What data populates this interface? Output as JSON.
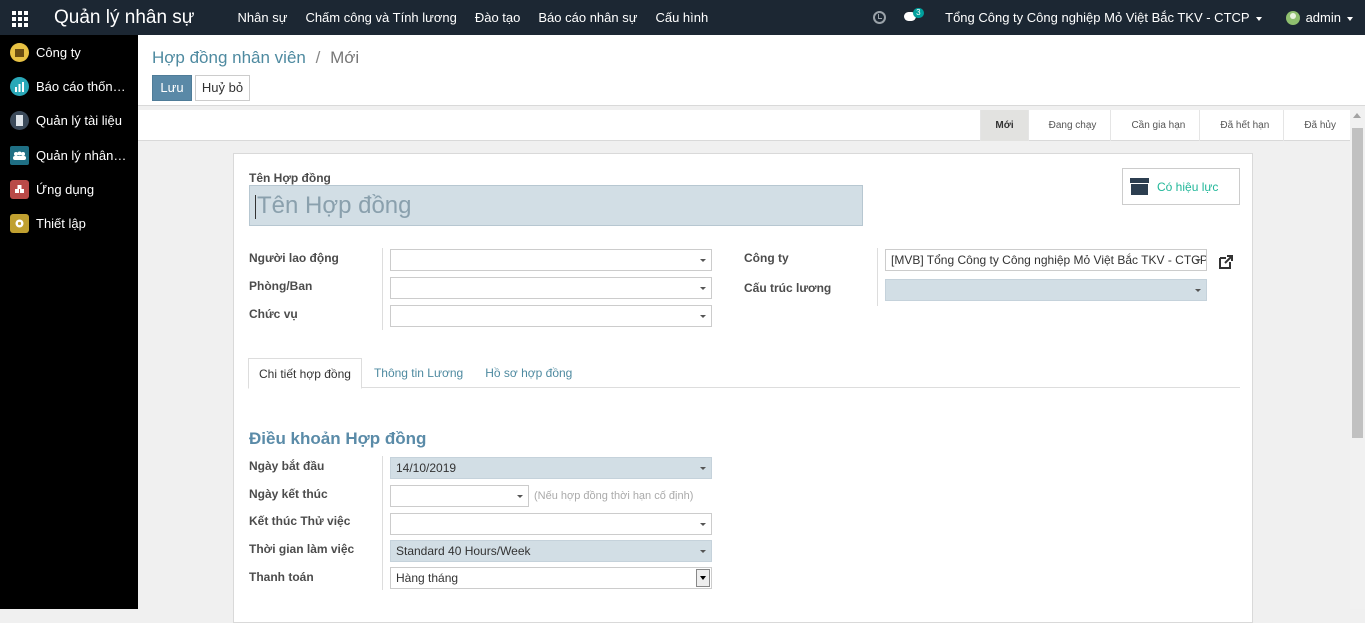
{
  "topbar": {
    "app_title": "Quản lý nhân sự",
    "menu": [
      "Nhân sự",
      "Chấm công và Tính lương",
      "Đào tạo",
      "Báo cáo nhân sự",
      "Cấu hình"
    ],
    "chat_count": "3",
    "company": "Tổng Công ty Công nghiệp Mỏ Việt Bắc TKV - CTCP",
    "user": "admin"
  },
  "sidebar": {
    "items": [
      {
        "label": "Công ty",
        "color": "#e8c244"
      },
      {
        "label": "Báo cáo thống kê",
        "color": "#2aa8b8"
      },
      {
        "label": "Quản lý tài liệu",
        "color": "#3b4a5a"
      },
      {
        "label": "Quản lý nhân sự",
        "color": "#1f6f84"
      },
      {
        "label": "Ứng dụng",
        "color": "#b94a48"
      },
      {
        "label": "Thiết lập",
        "color": "#c0a030"
      }
    ]
  },
  "breadcrumb": {
    "parent": "Hợp đồng nhân viên",
    "separator": "/",
    "current": "Mới"
  },
  "buttons": {
    "save": "Lưu",
    "cancel": "Huỷ bỏ"
  },
  "stages": [
    "Mới",
    "Đang chạy",
    "Cần gia hạn",
    "Đã hết hạn",
    "Đã hủy"
  ],
  "form": {
    "name_label": "Tên Hợp đồng",
    "name_placeholder": "Tên Hợp đồng",
    "smart_button": "Có hiệu lực",
    "employee_label": "Người lao động",
    "department_label": "Phòng/Ban",
    "job_label": "Chức vụ",
    "company_label": "Công ty",
    "company_value": "[MVB] Tổng Công ty Công nghiệp Mỏ Việt Bắc TKV - CTCP",
    "structure_label": "Cấu trúc lương",
    "tabs": [
      "Chi tiết hợp đồng",
      "Thông tin Lương",
      "Hồ sơ hợp đồng"
    ],
    "section_title": "Điều khoản Hợp đồng",
    "start_label": "Ngày bắt đầu",
    "start_value": "14/10/2019",
    "end_label": "Ngày kết thúc",
    "end_hint": "(Nếu hợp đồng thời hạn cố định)",
    "trial_label": "Kết thúc Thử việc",
    "schedule_label": "Thời gian làm việc",
    "schedule_value": "Standard 40 Hours/Week",
    "payment_label": "Thanh toán",
    "payment_value": "Hàng tháng"
  }
}
